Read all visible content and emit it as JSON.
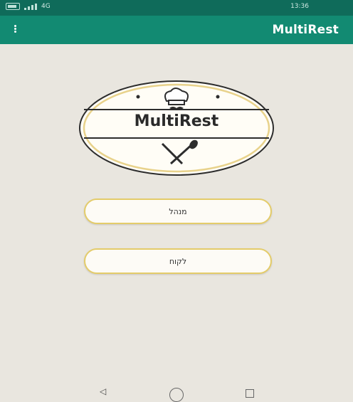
{
  "status_bar": {
    "time": "13:36",
    "network_label": "4G",
    "battery_icon": "battery-icon",
    "signal_icon": "signal-icon"
  },
  "app_bar": {
    "title": "MultiRest",
    "menu_icon": "overflow-menu-icon"
  },
  "logo": {
    "text": "MultiRest",
    "icons": [
      "chef-hat-icon",
      "mustache-icon",
      "crossed-utensils-icon"
    ]
  },
  "buttons": {
    "manager": "מנהל",
    "customer": "לקוח"
  },
  "nav_bar": {
    "back_icon": "back-icon",
    "home_icon": "home-icon",
    "recent_icon": "recent-apps-icon"
  },
  "colors": {
    "status_bar": "#0f6b5a",
    "app_bar": "#128a72",
    "background": "#e9e6df",
    "button_border": "#e4cc6a",
    "button_fill": "#fdfbf6"
  }
}
